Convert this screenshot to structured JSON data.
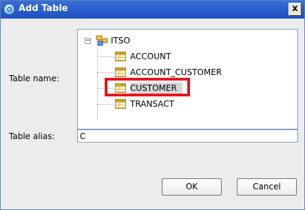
{
  "window": {
    "title": "Add Table",
    "close_glyph": "x"
  },
  "form": {
    "table_name_label": "Table name:",
    "table_alias_label": "Table alias:",
    "table_alias_value": "C"
  },
  "tree": {
    "root": "ITSO",
    "root_expander": "−",
    "items": [
      {
        "label": "ACCOUNT",
        "selected": false
      },
      {
        "label": "ACCOUNT_CUSTOMER",
        "selected": false
      },
      {
        "label": "CUSTOMER",
        "selected": true
      },
      {
        "label": "TRANSACT",
        "selected": false
      }
    ]
  },
  "buttons": {
    "ok": "OK",
    "cancel": "Cancel"
  },
  "colors": {
    "titlebar": "#2a5fcf",
    "highlight_border": "#e8141c",
    "selection": "#d6d6d6"
  }
}
